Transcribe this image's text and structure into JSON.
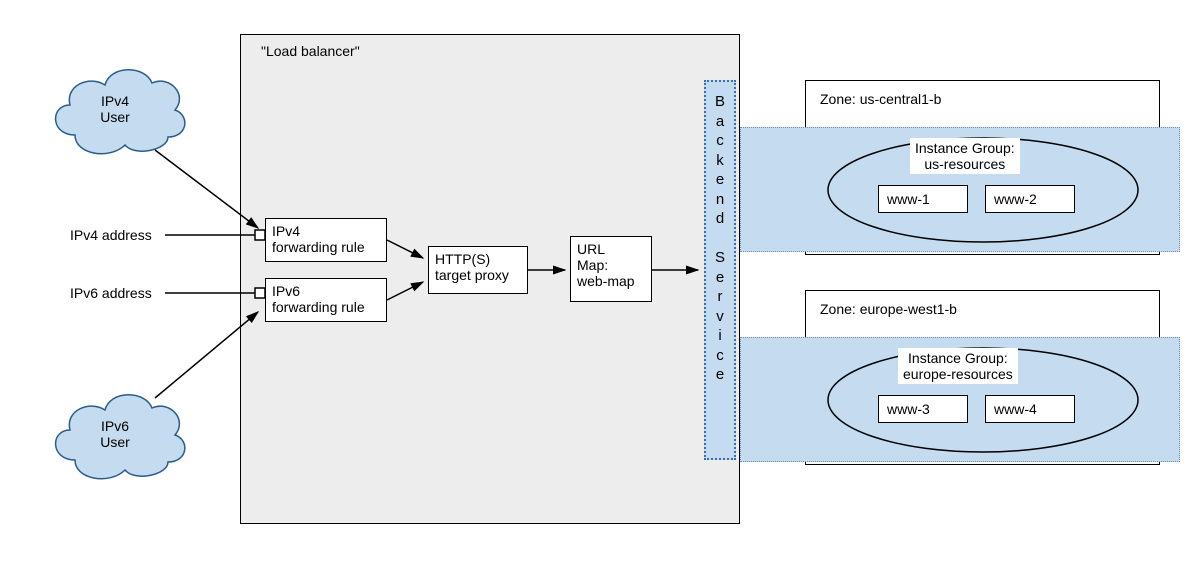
{
  "diagram": {
    "users": {
      "ipv4": "IPv4\nUser",
      "ipv6": "IPv6\nUser"
    },
    "address": {
      "ipv4": "IPv4 address",
      "ipv6": "IPv6 address"
    },
    "lb": {
      "title": "\"Load balancer\"",
      "fwd_ipv4": "IPv4\nforwarding rule",
      "fwd_ipv6": "IPv6\nforwarding rule",
      "proxy": "HTTP(S)\ntarget proxy",
      "urlmap": "URL\nMap:\nweb-map"
    },
    "backend_service": "Backend Service",
    "zones": [
      {
        "label": "Zone: us-central1-b",
        "ig_label": "Instance Group:\nus-resources",
        "instances": [
          "www-1",
          "www-2"
        ]
      },
      {
        "label": "Zone: europe-west1-b",
        "ig_label": "Instance Group:\neurope-resources",
        "instances": [
          "www-3",
          "www-4"
        ]
      }
    ]
  }
}
